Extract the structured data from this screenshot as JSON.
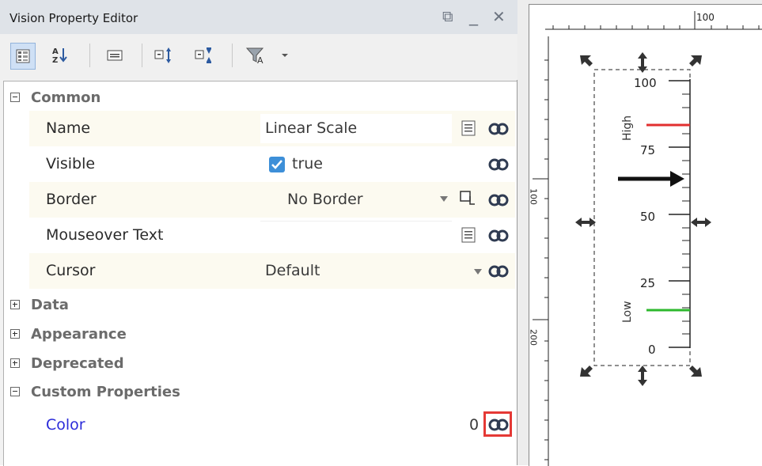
{
  "window": {
    "title": "Vision Property Editor",
    "buttons": {
      "restore": "⧉",
      "minimize": "_",
      "close": "✕"
    }
  },
  "toolbar": {
    "items": [
      "categorized-view-icon",
      "sort-alpha-icon",
      "show-standard-icon",
      "expand-all-icon",
      "collapse-all-icon",
      "filter-icon"
    ]
  },
  "categories": {
    "common": "Common",
    "data": "Data",
    "appearance": "Appearance",
    "deprecated": "Deprecated",
    "custom": "Custom Properties"
  },
  "properties": [
    {
      "name": "Name",
      "value": "Linear Scale"
    },
    {
      "name": "Visible",
      "value": "true"
    },
    {
      "name": "Border",
      "value": "No Border"
    },
    {
      "name": "Mouseover Text",
      "value": ""
    },
    {
      "name": "Cursor",
      "value": "Default"
    }
  ],
  "custom_properties": [
    {
      "name": "Color",
      "value": "0"
    }
  ],
  "canvas": {
    "ruler_top_label": "100",
    "ruler_left_labels": [
      "100",
      "200"
    ],
    "scale_ticks": [
      "100",
      "75",
      "50",
      "25",
      "0"
    ],
    "high_label": "High",
    "low_label": "Low",
    "colors": {
      "high": "#e23030",
      "low": "#2eb82e",
      "selection": "#e53935",
      "custom_name": "#2b2bd9"
    }
  }
}
